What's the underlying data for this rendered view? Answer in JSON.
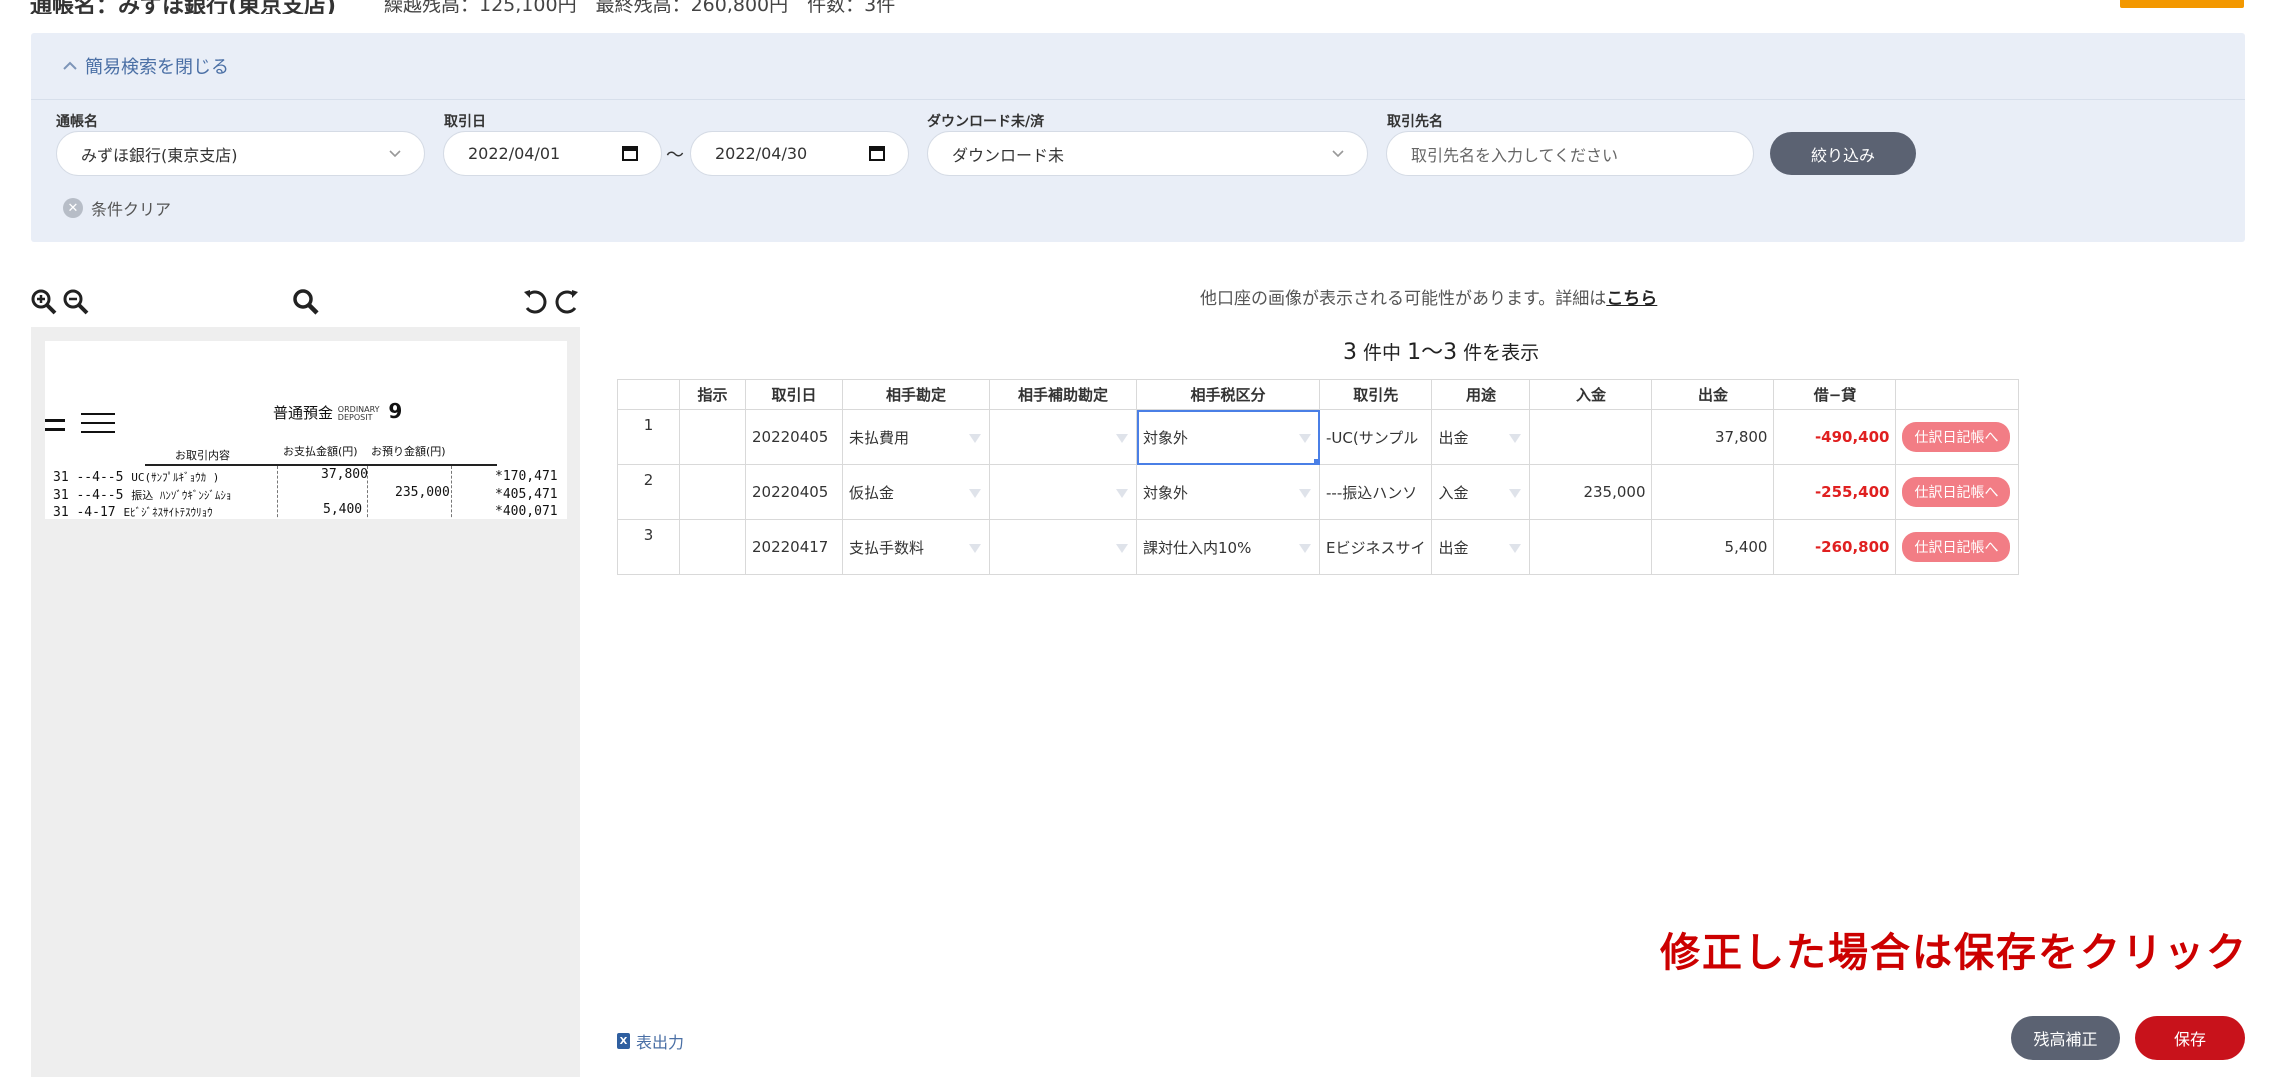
{
  "header": {
    "title": "通帳名：みずほ銀行(東京支店)",
    "summary": "繰越残高：125,100円　最終残高：260,800円　件数：3件"
  },
  "search": {
    "toggle_label": "簡易検索を閉じる",
    "passbook_label": "通帳名",
    "passbook_value": "みずほ銀行(東京支店)",
    "date_label": "取引日",
    "date_from": "2022/04/01",
    "date_to": "2022/04/30",
    "date_separator": "〜",
    "download_label": "ダウンロード未/済",
    "download_value": "ダウンロード未",
    "partner_label": "取引先名",
    "partner_placeholder": "取引先名を入力してください",
    "filter_button": "絞り込み",
    "clear_label": "条件クリア"
  },
  "viewer": {
    "doc_title": "普通預金",
    "doc_title_en_1": "ORDINARY",
    "doc_title_en_2": "DEPOSIT",
    "doc_page": "9",
    "col_desc": "お取引内容",
    "col_out": "お支払金額(円)",
    "col_in": "お預り金額(円)",
    "rows": [
      {
        "yr": "31",
        "date": "--4--5",
        "desc": "UC(ｻﾝﾌﾟﾙｷﾞｮｳｶ )",
        "out": "37,800",
        "in": "",
        "bal": "*170,471"
      },
      {
        "yr": "31",
        "date": "--4--5",
        "desc": "振込 ﾊﾝｿﾞｳｷﾞﾝｼﾞﾑｼｮ",
        "out": "",
        "in": "235,000",
        "bal": "*405,471"
      },
      {
        "yr": "31",
        "date": "-4-17",
        "desc": "Eﾋﾞｼﾞﾈｽｻｲﾄﾃｽｳﾘｮｳ",
        "out": "5,400",
        "in": "",
        "bal": "*400,071"
      }
    ]
  },
  "notice": {
    "text": "他口座の画像が表示される可能性があります。詳細は",
    "link": "こちら"
  },
  "count": {
    "total": "3",
    "label_mid": "件中",
    "range": "1〜3",
    "label_end": "件を表示"
  },
  "table": {
    "headers": [
      "",
      "指示",
      "取引日",
      "相手勘定",
      "相手補助勘定",
      "相手税区分",
      "取引先",
      "用途",
      "入金",
      "出金",
      "借−貸",
      ""
    ],
    "rows": [
      {
        "no": "1",
        "date": "20220405",
        "account": "未払費用",
        "sub": "",
        "tax": "対象外",
        "partner": "-UC(サンプル",
        "use": "出金",
        "in": "",
        "out": "37,800",
        "diff": "-490,400",
        "action": "仕訳日記帳へ"
      },
      {
        "no": "2",
        "date": "20220405",
        "account": "仮払金",
        "sub": "",
        "tax": "対象外",
        "partner": "---振込ハンソ",
        "use": "入金",
        "in": "235,000",
        "out": "",
        "diff": "-255,400",
        "action": "仕訳日記帳へ"
      },
      {
        "no": "3",
        "date": "20220417",
        "account": "支払手数料",
        "sub": "",
        "tax": "課対仕入内10%",
        "partner": "Eビジネスサイ",
        "use": "出金",
        "in": "",
        "out": "5,400",
        "diff": "-260,800",
        "action": "仕訳日記帳へ"
      }
    ]
  },
  "hint": "修正した場合は保存をクリック",
  "footer": {
    "export_icon": "X",
    "export_label": "表出力",
    "balance_button": "残高補正",
    "save_button": "保存"
  }
}
